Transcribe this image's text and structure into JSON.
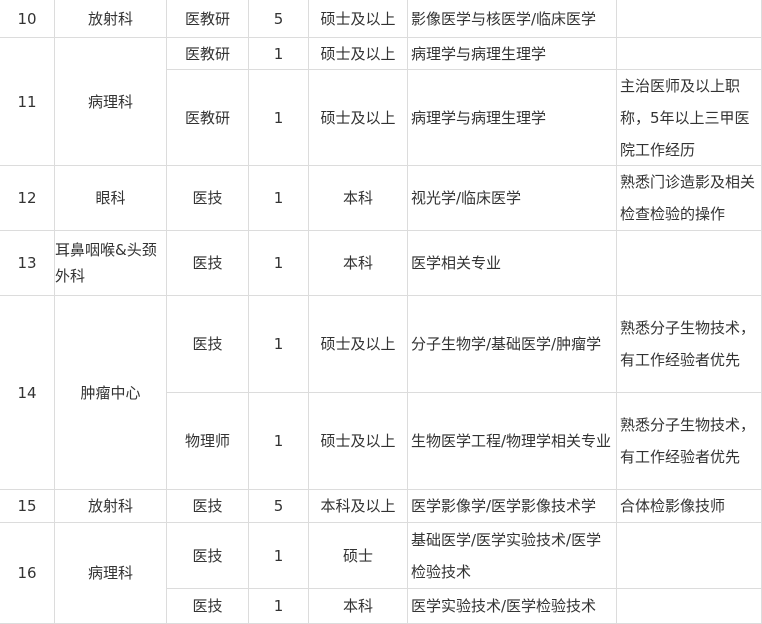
{
  "colors": {
    "grid_line": "#dcdcdc",
    "text": "#333333",
    "background": "#ffffff"
  },
  "rows": {
    "r10": {
      "no": "10",
      "dept": "放射科",
      "pos": "医教研",
      "count": "5",
      "edu": "硕士及以上",
      "major": "影像医学与核医学/临床医学",
      "note": ""
    },
    "r11a": {
      "pos": "医教研",
      "count": "1",
      "edu": "硕士及以上",
      "major": "病理学与病理生理学",
      "note": ""
    },
    "r11": {
      "no": "11",
      "dept": "病理科"
    },
    "r11b": {
      "pos": "医教研",
      "count": "1",
      "edu": "硕士及以上",
      "major": "病理学与病理生理学",
      "note": "主治医师及以上职称，5年以上三甲医院工作经历"
    },
    "r12": {
      "no": "12",
      "dept": "眼科",
      "pos": "医技",
      "count": "1",
      "edu": "本科",
      "major": "视光学/临床医学",
      "note": "熟悉门诊造影及相关检查检验的操作"
    },
    "r13": {
      "no": "13",
      "dept": "耳鼻咽喉&头颈外科",
      "pos": "医技",
      "count": "1",
      "edu": "本科",
      "major": "医学相关专业",
      "note": ""
    },
    "r14": {
      "no": "14",
      "dept": "肿瘤中心"
    },
    "r14a": {
      "pos": "医技",
      "count": "1",
      "edu": "硕士及以上",
      "major": "分子生物学/基础医学/肿瘤学",
      "note": "熟悉分子生物技术，有工作经验者优先"
    },
    "r14b": {
      "pos": "物理师",
      "count": "1",
      "edu": "硕士及以上",
      "major": "生物医学工程/物理学相关专业",
      "note": "熟悉分子生物技术，有工作经验者优先"
    },
    "r15": {
      "no": "15",
      "dept": "放射科",
      "pos": "医技",
      "count": "5",
      "edu": "本科及以上",
      "major": "医学影像学/医学影像技术学",
      "note": "合体检影像技师"
    },
    "r16": {
      "no": "16",
      "dept": "病理科"
    },
    "r16a": {
      "pos": "医技",
      "count": "1",
      "edu": "硕士",
      "major": "基础医学/医学实验技术/医学检验技术",
      "note": ""
    },
    "r16b": {
      "pos": "医技",
      "count": "1",
      "edu": "本科",
      "major": "医学实验技术/医学检验技术",
      "note": ""
    }
  }
}
